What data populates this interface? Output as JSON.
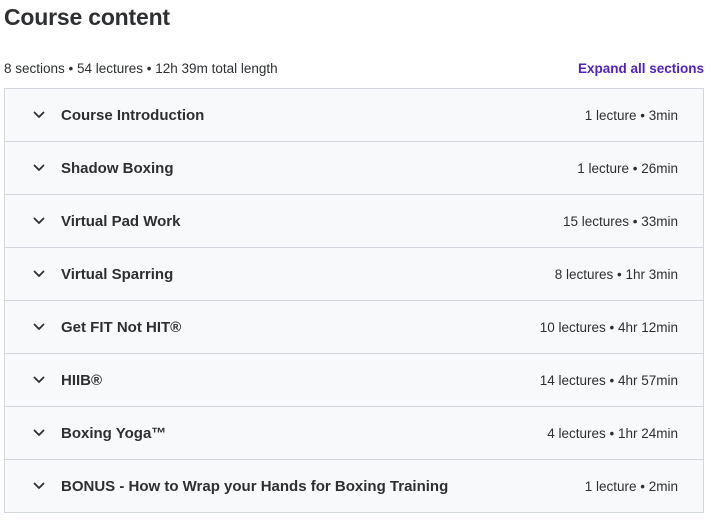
{
  "header": {
    "title": "Course content"
  },
  "summary": {
    "text": "8 sections • 54 lectures • 12h 39m total length",
    "expand_label": "Expand all sections"
  },
  "sections": [
    {
      "title": "Course Introduction",
      "meta": "1 lecture • 3min",
      "icon": "chevron-down-icon"
    },
    {
      "title": "Shadow Boxing",
      "meta": "1 lecture • 26min",
      "icon": "chevron-down-icon"
    },
    {
      "title": "Virtual Pad Work",
      "meta": "15 lectures • 33min",
      "icon": "chevron-down-icon"
    },
    {
      "title": "Virtual Sparring",
      "meta": "8 lectures • 1hr 3min",
      "icon": "chevron-down-icon"
    },
    {
      "title": "Get FIT Not HIT®",
      "meta": "10 lectures • 4hr 12min",
      "icon": "chevron-down-icon"
    },
    {
      "title": "HIIB®",
      "meta": "14 lectures • 4hr 57min",
      "icon": "chevron-down-icon"
    },
    {
      "title": "Boxing Yoga™",
      "meta": "4 lectures • 1hr 24min",
      "icon": "chevron-down-icon"
    },
    {
      "title": "BONUS - How to Wrap your Hands for Boxing Training",
      "meta": "1 lecture • 2min",
      "icon": "chevron-down-icon"
    }
  ],
  "colors": {
    "text": "#2d2f31",
    "accent": "#5022c3",
    "row_background": "#f7f9fa",
    "border": "#d1d7dc"
  }
}
